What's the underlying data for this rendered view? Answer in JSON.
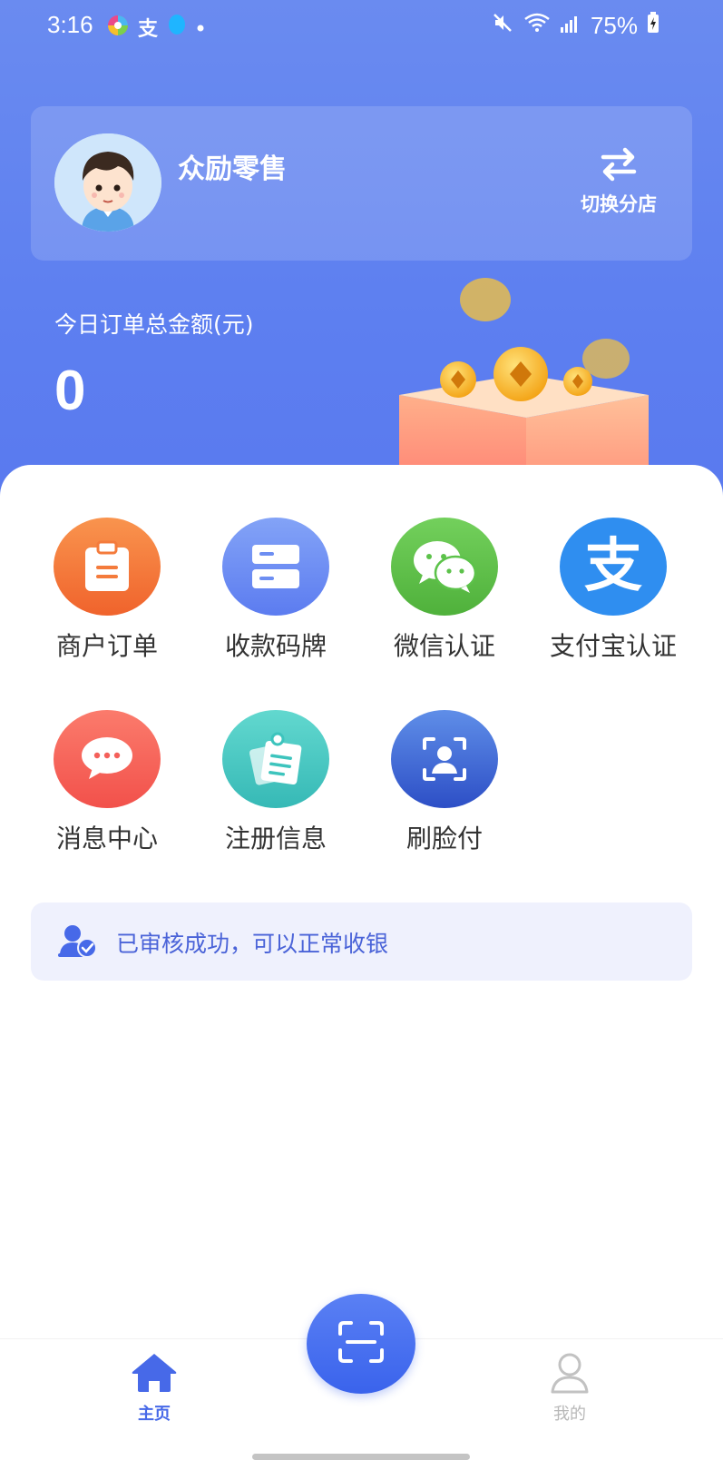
{
  "status_bar": {
    "time": "3:16",
    "app_icons": [
      "colorful-app-icon",
      "alipay-icon",
      "qq-icon"
    ],
    "battery": "75%"
  },
  "store_card": {
    "name": "众励零售",
    "switch_label": "切换分店"
  },
  "summary": {
    "label": "今日订单总金额(元)",
    "value": "0"
  },
  "menu": [
    {
      "label": "商户订单",
      "icon": "clipboard-icon",
      "color": "#f47b3c"
    },
    {
      "label": "收款码牌",
      "icon": "server-card-icon",
      "color": "#6d8ef2"
    },
    {
      "label": "微信认证",
      "icon": "wechat-icon",
      "color": "#5cc24a"
    },
    {
      "label": "支付宝认证",
      "icon": "alipay-icon",
      "color": "#2f8ef0"
    },
    {
      "label": "消息中心",
      "icon": "chat-bubble-icon",
      "color": "#f4605a"
    },
    {
      "label": "注册信息",
      "icon": "notes-icon",
      "color": "#3dc4bd"
    },
    {
      "label": "刷脸付",
      "icon": "face-scan-icon",
      "color": "#3f67d6"
    }
  ],
  "notice": {
    "text": "已审核成功，可以正常收银"
  },
  "bottom_nav": {
    "home_label": "主页",
    "mine_label": "我的"
  },
  "colors": {
    "accent": "#4769e8",
    "hero_blue": "#5d7ff0"
  }
}
